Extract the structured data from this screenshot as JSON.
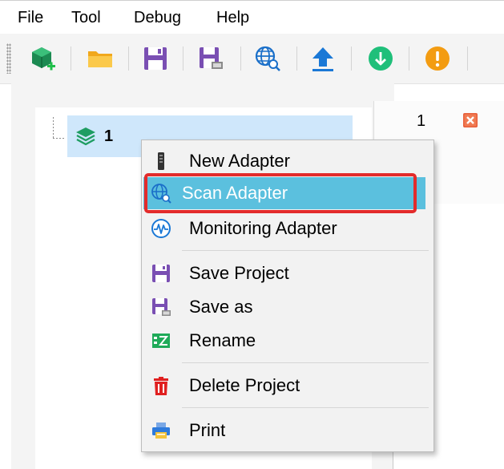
{
  "menubar": {
    "items": [
      {
        "label": "File"
      },
      {
        "label": "Tool"
      },
      {
        "label": "Debug"
      },
      {
        "label": "Help"
      }
    ]
  },
  "toolbar": {
    "buttons": [
      {
        "icon": "new-project-icon"
      },
      {
        "icon": "open-folder-icon"
      },
      {
        "icon": "save-icon"
      },
      {
        "icon": "save-as-icon"
      },
      {
        "icon": "scan-globe-icon"
      },
      {
        "icon": "upload-arrow-icon"
      },
      {
        "icon": "download-circle-icon"
      },
      {
        "icon": "warning-circle-icon"
      }
    ]
  },
  "tree": {
    "node_label": "1"
  },
  "tab": {
    "label": "1"
  },
  "context_menu": {
    "items": [
      {
        "label": "New Adapter",
        "icon": "adapter-device-icon"
      },
      {
        "label": "Scan Adapter",
        "icon": "scan-globe-icon",
        "highlighted": true
      },
      {
        "label": "Monitoring Adapter",
        "icon": "monitor-wave-icon"
      },
      {
        "label": "Save Project",
        "icon": "save-icon"
      },
      {
        "label": "Save as",
        "icon": "save-as-icon"
      },
      {
        "label": "Rename",
        "icon": "rename-icon"
      },
      {
        "label": "Delete Project",
        "icon": "trash-icon"
      },
      {
        "label": "Print",
        "icon": "printer-icon"
      }
    ]
  },
  "colors": {
    "highlight": "#5bc0de",
    "annotation_box": "#e32b2b",
    "tree_selection": "#cfe7fb",
    "save_purple": "#7a4fb3",
    "accent_green": "#1fbf7a",
    "accent_orange": "#f39c12",
    "accent_blue": "#1a78d6"
  }
}
